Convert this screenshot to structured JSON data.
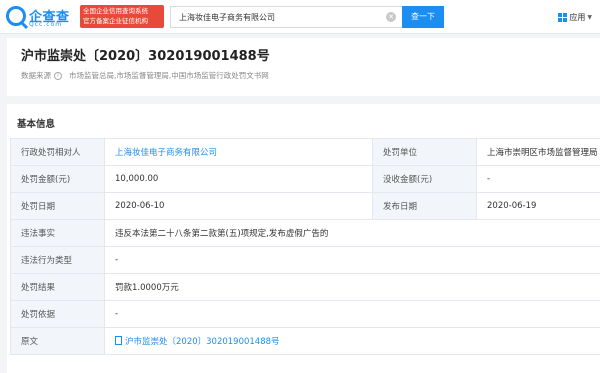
{
  "brand": {
    "name": "企查查",
    "domain": "Qcc.com",
    "promo_line1": "全国企业信用查询系统",
    "promo_line2": "官方备案企业征信机构",
    "accent": "#1c8ef2",
    "promo_color": "#e84a3a"
  },
  "search": {
    "value": "上海妆佳电子商务有限公司",
    "button_label": "查一下"
  },
  "apps": {
    "label": "应用"
  },
  "record": {
    "title": "沪市监崇处〔2020〕302019001488号",
    "source_label": "数据来源",
    "source_value": "市场监管总局,市场监督管理局,中国市场监管行政处罚文书网"
  },
  "basic": {
    "section_title": "基本信息",
    "rows": [
      {
        "label": "行政处罚相对人",
        "value": "上海妆佳电子商务有限公司",
        "label2": "处罚单位",
        "value2": "上海市崇明区市场监督管理局"
      },
      {
        "label": "处罚金额(元)",
        "value": "10,000.00",
        "label2": "没收金额(元)",
        "value2": "-"
      },
      {
        "label": "处罚日期",
        "value": "2020-06-10",
        "label2": "发布日期",
        "value2": "2020-06-19"
      },
      {
        "label": "违法事实",
        "value": "违反本法第二十八条第二款第(五)项规定,发布虚假广告的"
      },
      {
        "label": "违法行为类型",
        "value": "-"
      },
      {
        "label": "处罚结果",
        "value": "罚款1.0000万元"
      },
      {
        "label": "处罚依据",
        "value": "-"
      },
      {
        "label": "原文",
        "value": "沪市监崇处〔2020〕302019001488号"
      }
    ]
  }
}
